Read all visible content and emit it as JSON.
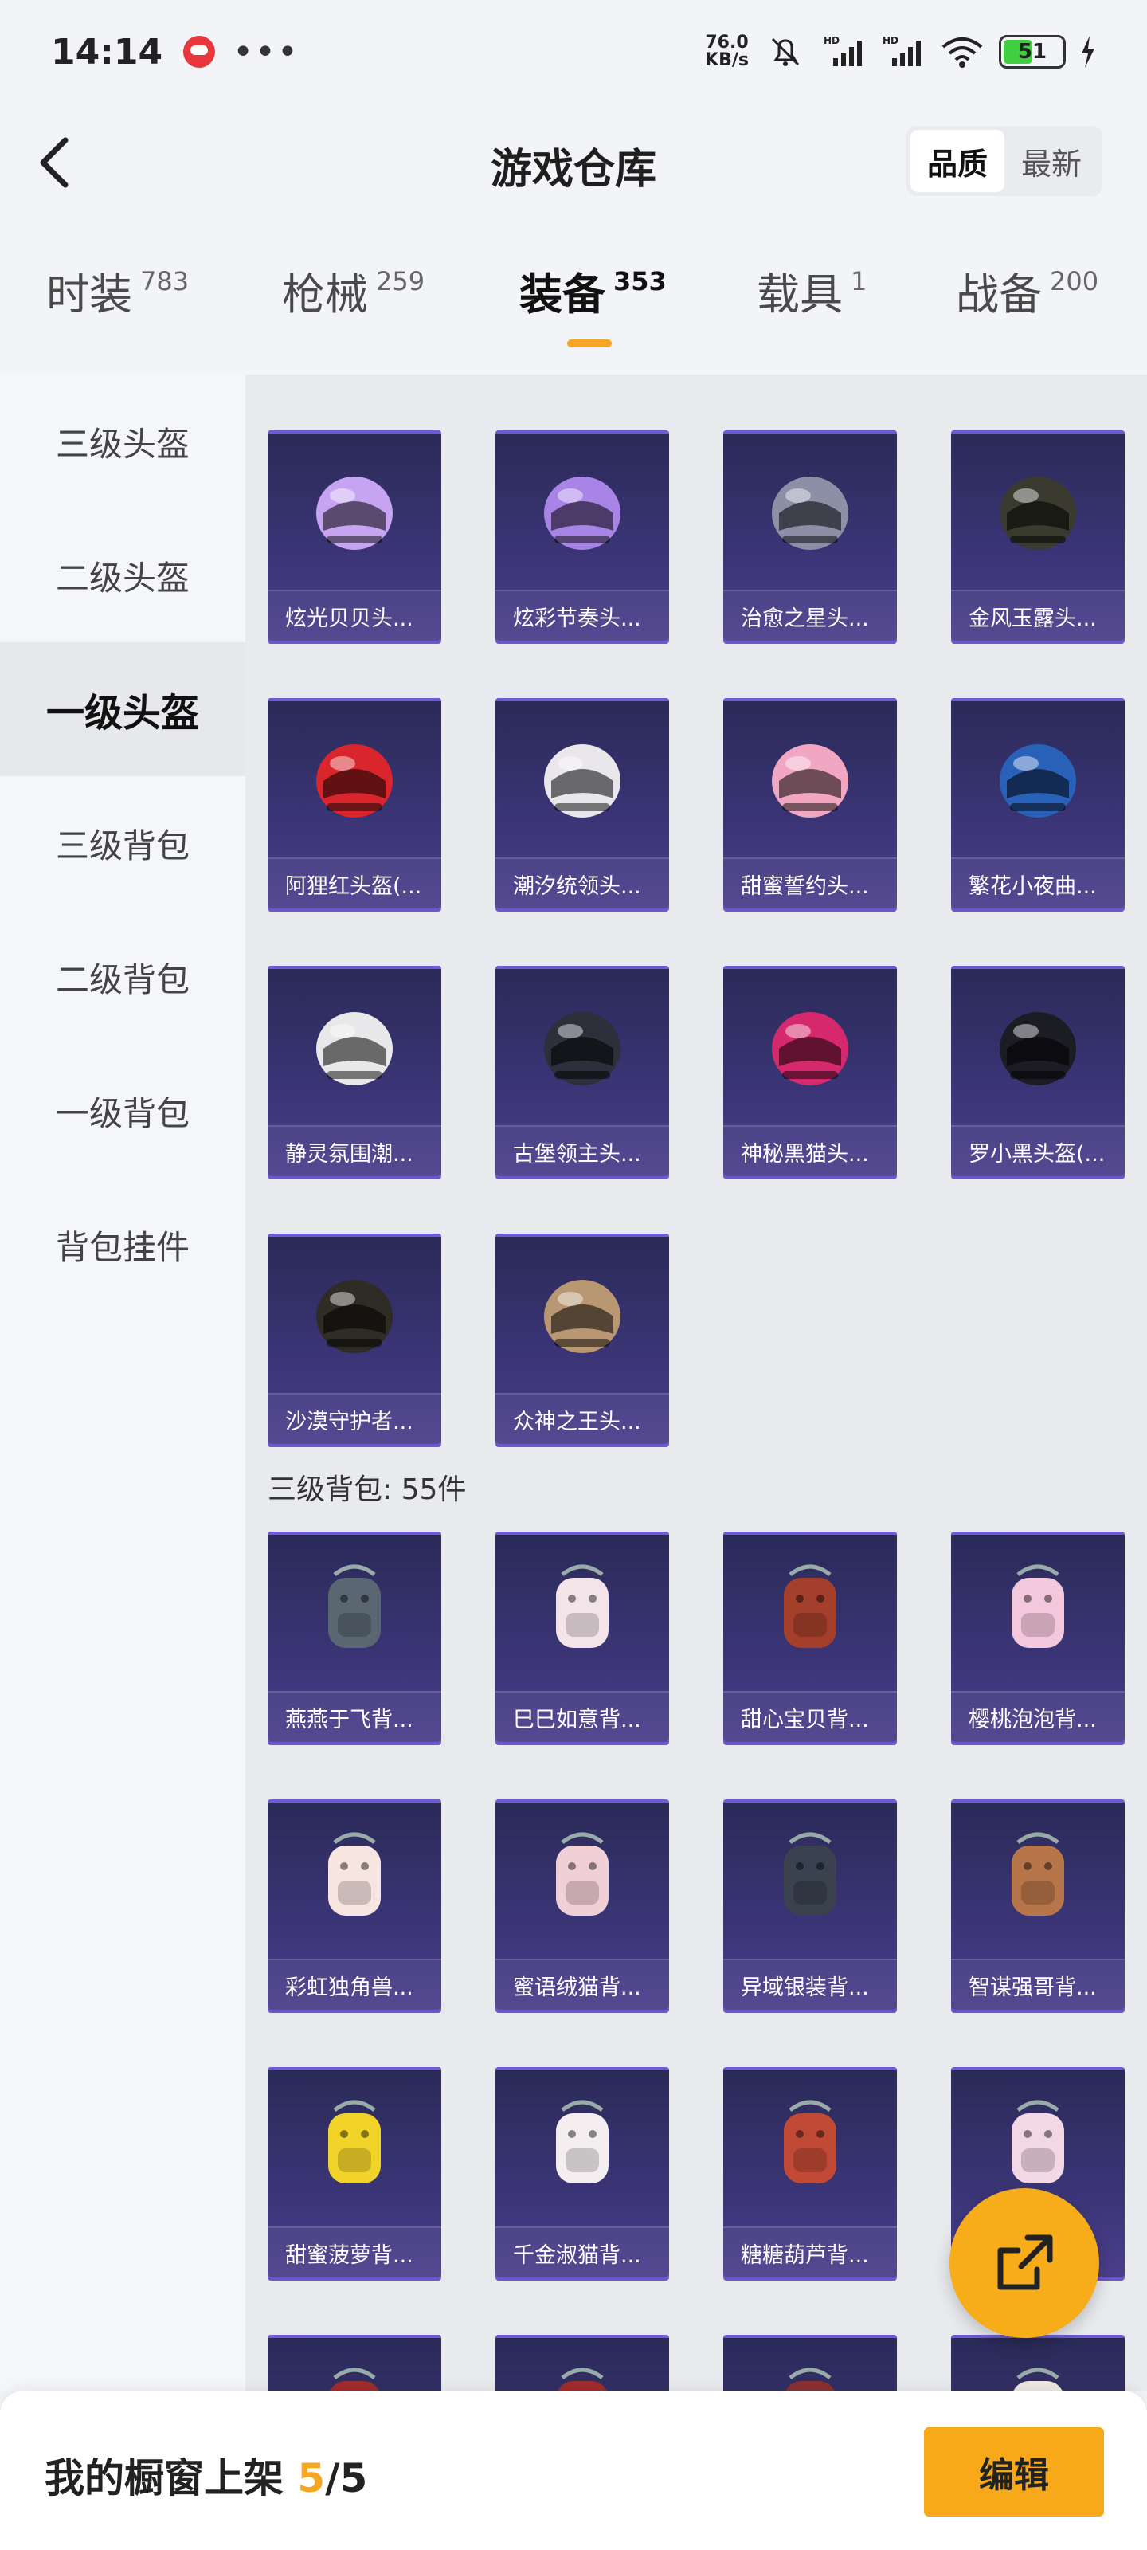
{
  "status_bar": {
    "time": "14:14",
    "speed_value": "76.0",
    "speed_unit": "KB/s",
    "battery": "51"
  },
  "header": {
    "title": "游戏仓库",
    "sort_options": [
      "品质",
      "最新"
    ],
    "sort_active": "品质"
  },
  "tabs": [
    {
      "label": "时装",
      "count": "783"
    },
    {
      "label": "枪械",
      "count": "259"
    },
    {
      "label": "装备",
      "count": "353",
      "active": true
    },
    {
      "label": "载具",
      "count": "1"
    },
    {
      "label": "战备",
      "count": "200"
    }
  ],
  "sidebar": {
    "items": [
      "三级头盔",
      "二级头盔",
      "一级头盔",
      "三级背包",
      "二级背包",
      "一级背包",
      "背包挂件"
    ],
    "active_index": 2
  },
  "helmets": [
    {
      "name": "炫光贝贝头...",
      "color": "#c7a4f2"
    },
    {
      "name": "炫彩节奏头...",
      "color": "#a884e6"
    },
    {
      "name": "治愈之星头...",
      "color": "#8d8fa6"
    },
    {
      "name": "金风玉露头...",
      "color": "#3a3a2e"
    },
    {
      "name": "阿狸红头盔(...",
      "color": "#d8262c"
    },
    {
      "name": "潮汐统领头...",
      "color": "#e9e6ec"
    },
    {
      "name": "甜蜜誓约头...",
      "color": "#f1a7c1"
    },
    {
      "name": "繁花小夜曲...",
      "color": "#2a61b8"
    },
    {
      "name": "静灵氛围潮...",
      "color": "#e8e8ea"
    },
    {
      "name": "古堡领主头...",
      "color": "#2d2f3b"
    },
    {
      "name": "神秘黑猫头...",
      "color": "#d6286c"
    },
    {
      "name": "罗小黑头盔(...",
      "color": "#1c1c24"
    },
    {
      "name": "沙漠守护者...",
      "color": "#2f2b25"
    },
    {
      "name": "众神之王头...",
      "color": "#b89772"
    }
  ],
  "backpack_section": {
    "title": "三级背包: 55件"
  },
  "backpacks": [
    {
      "name": "燕燕于飞背...",
      "color": "#5a6672"
    },
    {
      "name": "巳巳如意背...",
      "color": "#f3e4ea"
    },
    {
      "name": "甜心宝贝背...",
      "color": "#a33f2b"
    },
    {
      "name": "樱桃泡泡背...",
      "color": "#f4c8dc"
    },
    {
      "name": "彩虹独角兽...",
      "color": "#f6e5e0"
    },
    {
      "name": "蜜语绒猫背...",
      "color": "#f1cfd6"
    },
    {
      "name": "异域银装背...",
      "color": "#3a4250"
    },
    {
      "name": "智谋强哥背...",
      "color": "#b7754a"
    },
    {
      "name": "甜蜜菠萝背...",
      "color": "#f2d32a"
    },
    {
      "name": "千金淑猫背...",
      "color": "#f5eef0"
    },
    {
      "name": "糖糖葫芦背...",
      "color": "#c04a35"
    },
    {
      "name": "",
      "color": "#f2d8e4"
    },
    {
      "name": "",
      "color": "#a02c2c"
    },
    {
      "name": "",
      "color": "#a02c2c"
    },
    {
      "name": "",
      "color": "#8a3030"
    },
    {
      "name": "",
      "color": "#eee8e0"
    }
  ],
  "bottom_bar": {
    "label": "我的橱窗上架 ",
    "current": "5",
    "separator": "/",
    "total": "5",
    "edit_label": "编辑"
  }
}
